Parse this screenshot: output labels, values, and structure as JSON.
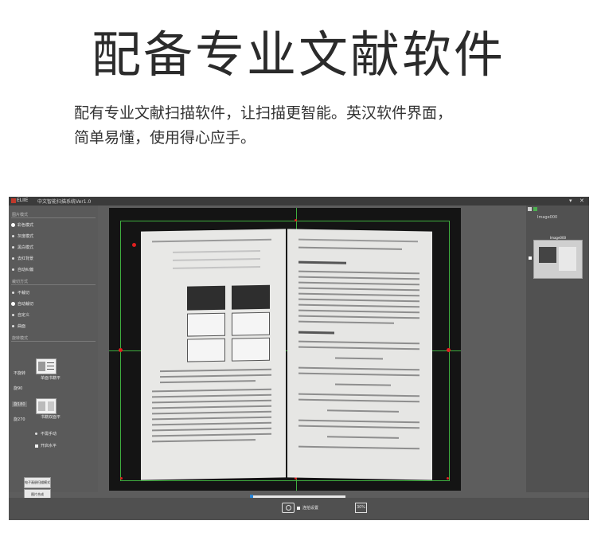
{
  "headline": "配备专业文献软件",
  "description": [
    "配有专业文献扫描软件，让扫描更智能。英汉软件界面，",
    "简单易懂，使用得心应手。"
  ],
  "app": {
    "brand": "ELIIE",
    "window_title": "中文智能扫描系统Ver1.0",
    "controls": {
      "minimize": "▾",
      "close": "✕"
    },
    "sidebar": {
      "color_mode_title": "图片模式",
      "color_modes": [
        {
          "label": "彩色模式",
          "selected": true
        },
        {
          "label": "灰度模式",
          "selected": false
        },
        {
          "label": "黑白模式",
          "selected": false
        },
        {
          "label": "去红背景",
          "selected": false
        },
        {
          "label": "自动纠偏",
          "selected": false
        }
      ],
      "crop_title": "裁切方式",
      "crop_modes": [
        {
          "label": "不裁切",
          "selected": false
        },
        {
          "label": "自动裁切",
          "selected": true
        },
        {
          "label": "自定义",
          "selected": false
        },
        {
          "label": "曲面",
          "selected": false
        }
      ],
      "rotate_title": "旋转模式",
      "rotations": [
        {
          "label": "不旋转",
          "selected": false
        },
        {
          "label": "旋90",
          "selected": false
        },
        {
          "label": "旋180",
          "selected": true
        },
        {
          "label": "旋270",
          "selected": false
        }
      ],
      "capture_single_label": "单面书籍平",
      "capture_double_label": "书籍双面平",
      "checkbox_1": "不需手动",
      "checkbox_2": "开启水平",
      "button_main": "电子画册扫描模式",
      "button_sub": "图片合成"
    },
    "right_panel": {
      "header": "Image000",
      "thumb_label": "Image000"
    },
    "bottom": {
      "auto_capture_label": "连拍设置",
      "zoom_label": "30%"
    },
    "colors": {
      "guide": "#3fae3f",
      "corner": "#e01f1f",
      "accent": "#2a86d8"
    }
  }
}
